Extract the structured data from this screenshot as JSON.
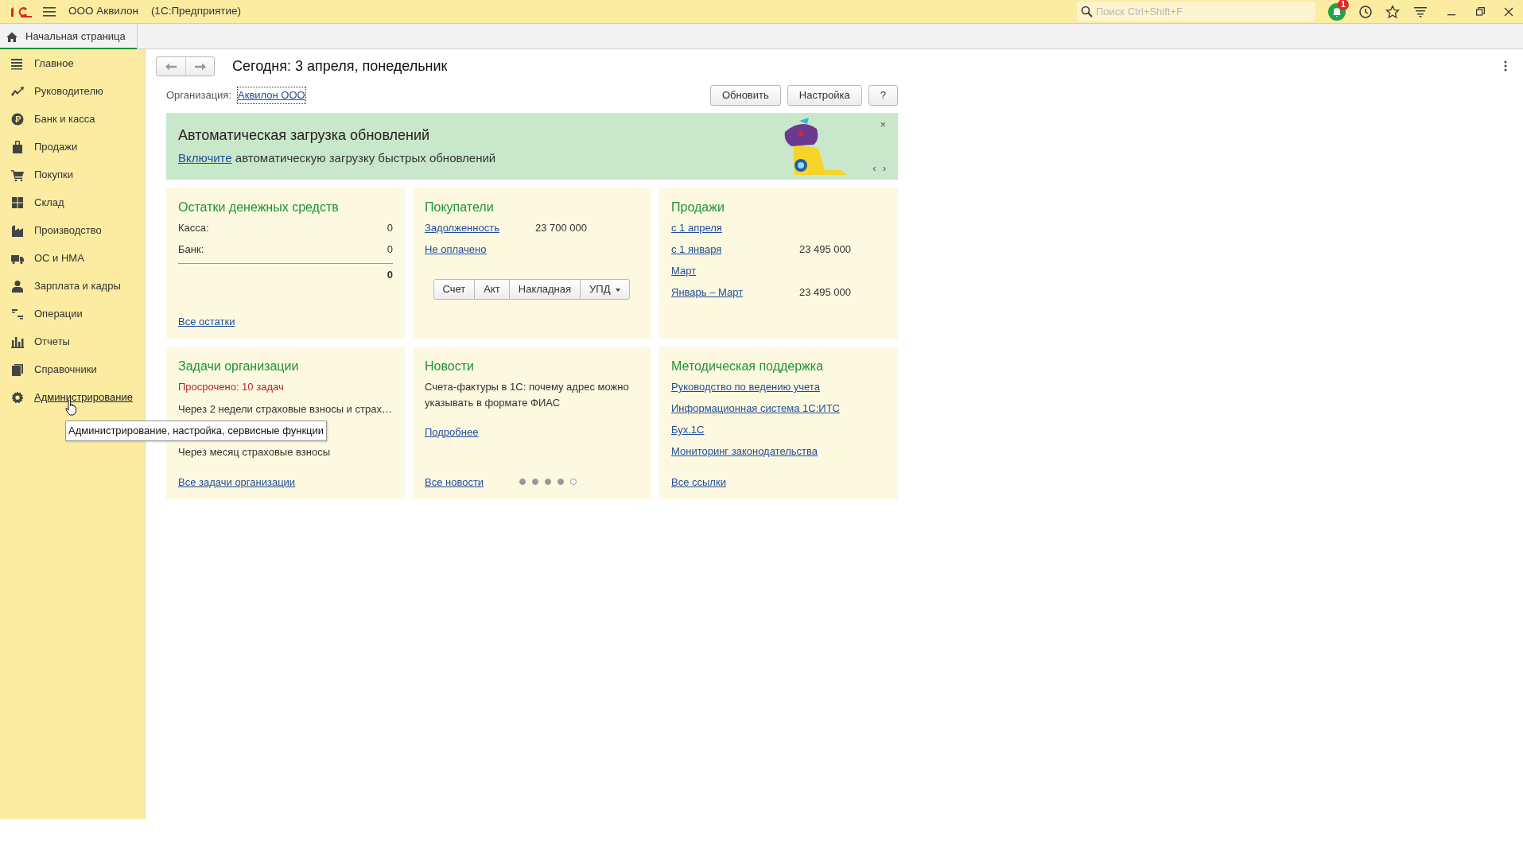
{
  "window": {
    "title": "ООО Аквилон",
    "subtitle": "(1С:Предприятие)",
    "search": {
      "placeholder": "Поиск Ctrl+Shift+F"
    },
    "notification_count": "1"
  },
  "tabs": [
    {
      "label": "Начальная страница",
      "selected": true
    }
  ],
  "sidebar": {
    "items": [
      {
        "label": "Главное",
        "kind": "list",
        "hovered": false
      },
      {
        "label": "Руководителю",
        "kind": "trend",
        "hovered": false
      },
      {
        "label": "Банк и касса",
        "kind": "coin",
        "hovered": false
      },
      {
        "label": "Продажи",
        "kind": "bag",
        "hovered": false
      },
      {
        "label": "Покупки",
        "kind": "cart",
        "hovered": false
      },
      {
        "label": "Склад",
        "kind": "grid",
        "hovered": false
      },
      {
        "label": "Производство",
        "kind": "factory",
        "hovered": false
      },
      {
        "label": "ОС и НМА",
        "kind": "truck",
        "hovered": false
      },
      {
        "label": "Зарплата и кадры",
        "kind": "person",
        "hovered": false
      },
      {
        "label": "Операции",
        "kind": "ledger",
        "hovered": false
      },
      {
        "label": "Отчеты",
        "kind": "bars",
        "hovered": false
      },
      {
        "label": "Справочники",
        "kind": "books",
        "hovered": false
      },
      {
        "label": "Администрирование",
        "kind": "gear",
        "hovered": true
      }
    ]
  },
  "tooltip": "Администрирование, настройка, сервисные функции",
  "page": {
    "title": "Сегодня: 3 апреля, понедельник",
    "organization_label": "Организация:",
    "organization": "Аквилон ООО",
    "buttons": [
      "Обновить",
      "Настройка",
      "?"
    ]
  },
  "banner": {
    "title": "Автоматическая загрузка обновлений",
    "link": "Включите",
    "text": "автоматическую загрузку быстрых обновлений",
    "close": "×",
    "prev": "‹",
    "next": "›"
  },
  "cards": [
    {
      "kind": "balances",
      "title": "Остатки денежных средств",
      "rows": [
        {
          "label": "Касса:",
          "value": "0"
        },
        {
          "label": "Банк:",
          "value": "0"
        }
      ],
      "total": "0",
      "footer_link": "Все остатки"
    },
    {
      "kind": "customers",
      "title": "Покупатели",
      "rows": [
        {
          "link": "Задолженность",
          "value": "23 700 000"
        },
        {
          "link": "Не оплачено"
        }
      ],
      "buttons": [
        {
          "label": "Счет",
          "dropdown": false
        },
        {
          "label": "Акт",
          "dropdown": false
        },
        {
          "label": "Накладная",
          "dropdown": false
        },
        {
          "label": "УПД",
          "dropdown": true
        }
      ]
    },
    {
      "kind": "sales",
      "title": "Продажи",
      "rows": [
        {
          "link": "с 1 апреля"
        },
        {
          "link": "с 1 января",
          "value": "23 495 000"
        },
        {
          "link": "Март"
        },
        {
          "link": "Январь – Март",
          "value": "23 495 000"
        }
      ]
    },
    {
      "kind": "tasks",
      "title": "Задачи организации",
      "overdue": "Просрочено: 10 задач",
      "items": [
        "Через 2 недели страховые взносы и страх…",
        "Через месяц страховые взносы"
      ],
      "footer_link": "Все задачи организации"
    },
    {
      "kind": "news",
      "title": "Новости",
      "text": "Счета-фактуры в 1С: почему адрес можно указывать в формате ФИАС",
      "more_link": "Подробнее",
      "footer_link": "Все новости",
      "dots": [
        {
          "selected": false
        },
        {
          "selected": false
        },
        {
          "selected": false
        },
        {
          "selected": false
        },
        {
          "selected": true
        }
      ]
    },
    {
      "kind": "links",
      "title": "Методическая поддержка",
      "links": [
        "Руководство по ведению учета",
        "Информационная система 1С:ИТС",
        "Бух.1С",
        "Мониторинг законодательства"
      ],
      "footer_link": "Все ссылки"
    }
  ]
}
